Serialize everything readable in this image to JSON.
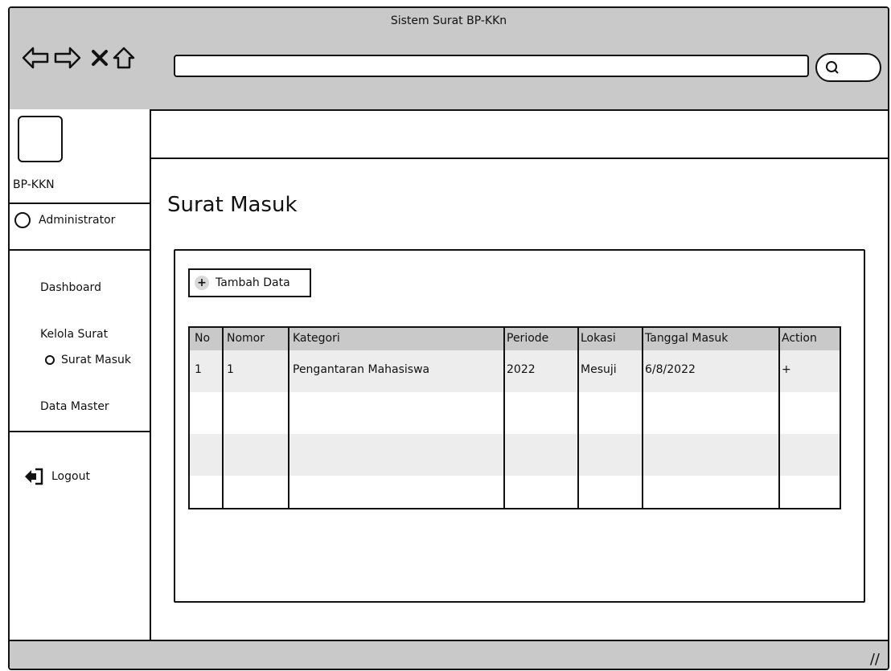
{
  "window": {
    "title": "Sistem Surat BP-KKn"
  },
  "sidebar": {
    "brand": "BP-KKN",
    "user": "Administrator",
    "items": {
      "dashboard": "Dashboard",
      "kelola": "Kelola Surat",
      "surat_masuk": "Surat Masuk",
      "data_master": "Data Master"
    },
    "logout": "Logout"
  },
  "main": {
    "title": "Surat Masuk",
    "add_button": "Tambah Data",
    "table": {
      "headers": [
        "No",
        "Nomor",
        "Kategori",
        "Periode",
        "Lokasi",
        "Tanggal Masuk",
        "Action"
      ],
      "rows": [
        [
          "1",
          "1",
          "Pengantaran Mahasiswa",
          "2022",
          "Mesuji",
          "6/8/2022",
          "+"
        ]
      ]
    }
  },
  "colors": {
    "chrome": "#c9c9c9",
    "band": "#ededed",
    "line": "#111111"
  },
  "icons": [
    "back-arrow-icon",
    "forward-arrow-icon",
    "close-icon",
    "home-icon",
    "search-icon",
    "plus-icon",
    "logout-icon"
  ]
}
